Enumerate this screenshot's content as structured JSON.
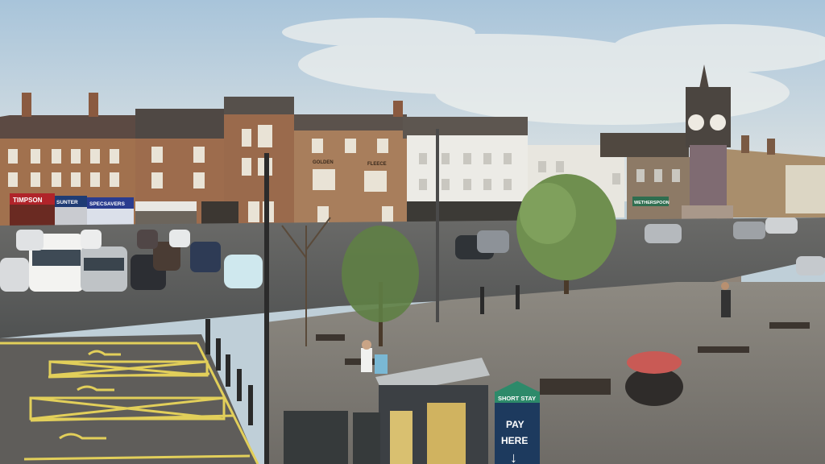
{
  "scene": {
    "shop_signs": {
      "timpson": "TIMPSON",
      "boots_like": "SUNTER",
      "blue_shop": "SPECSAVERS",
      "golden_fleece_left": "GOLDEN",
      "golden_fleece_right": "FLEECE",
      "green_shop": "WETHERSPOON"
    },
    "parking_sign": {
      "line1": "SHORT STAY",
      "line2": "PAY",
      "line3": "HERE",
      "arrow": "↓"
    },
    "colors": {
      "sky_top": "#a9c6dc",
      "sky_bottom": "#dfe4e4",
      "brick": "#9c6e4c",
      "roof": "#5a4a44",
      "road": "#55585a",
      "paving": "#7f7b74",
      "accessible_bay_line": "#e2cf5a",
      "tree": "#6f8f4f",
      "sign_green": "#2d8a6a",
      "sign_navy": "#1d3a5e"
    }
  }
}
